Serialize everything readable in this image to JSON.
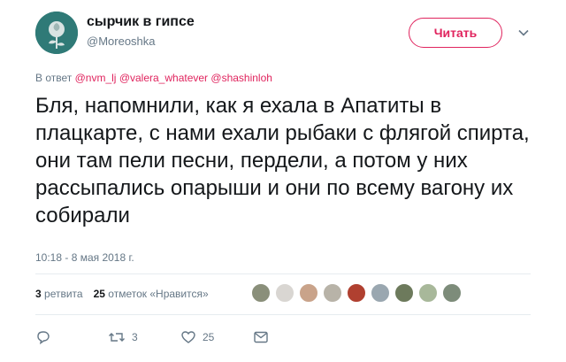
{
  "author": {
    "name": "сырчик в гипсе",
    "handle": "@Moreoshka",
    "avatar_icon": "rose-avatar-icon"
  },
  "follow_button_label": "Читать",
  "reply_to": {
    "prefix": "В ответ",
    "mentions": [
      "@nvm_lj",
      "@valera_whatever",
      "@shashinloh"
    ]
  },
  "tweet_text": "Бля, напомнили, как я ехала в Апатиты в плацкарте, с нами ехали рыбаки с флягой спирта, они там пели песни, пердели, а потом у них рассыпались опарыши и они по всему вагону их собирали",
  "timestamp": "10:18 - 8 мая 2018 г.",
  "stats": {
    "retweets_count": "3",
    "retweets_label": "ретвита",
    "likes_count": "25",
    "likes_label": "отметок «Нравится»"
  },
  "liker_avatars": [
    "#8a8f7a",
    "#d9d6d2",
    "#c9a38a",
    "#b8b3a8",
    "#b04030",
    "#9aa7b0",
    "#6d7a5c",
    "#a8b89a",
    "#7d8c7a"
  ],
  "actions": {
    "reply_icon": "reply-icon",
    "retweet_icon": "retweet-icon",
    "retweet_count": "3",
    "like_icon": "heart-icon",
    "like_count": "25",
    "dm_icon": "envelope-icon"
  },
  "colors": {
    "accent": "#e0245e",
    "secondary_text": "#657786",
    "divider": "#e6ecf0"
  }
}
